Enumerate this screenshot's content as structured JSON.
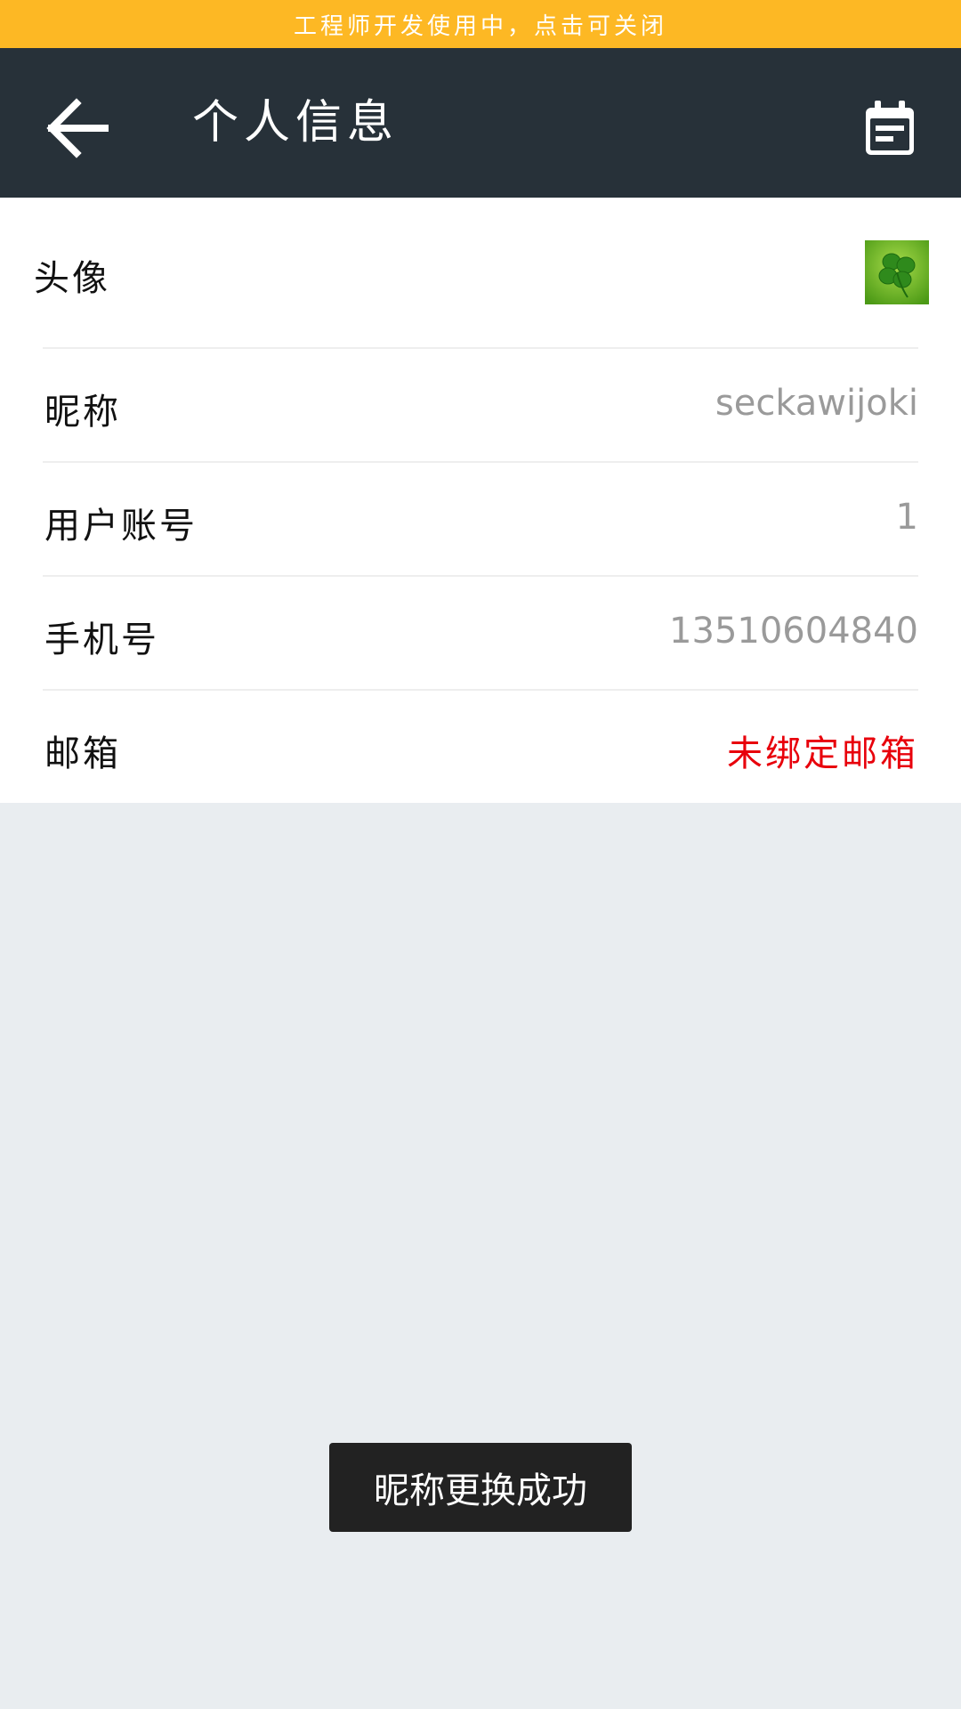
{
  "dev_banner": {
    "text": "工程师开发使用中，点击可关闭",
    "bg_color": "#fdb824"
  },
  "header": {
    "title": "个人信息",
    "back_icon": "arrow-left-icon",
    "action_icon": "calendar-note-icon",
    "bg_color": "#273139"
  },
  "profile": {
    "avatar": {
      "label": "头像",
      "image": "four-leaf-clover"
    },
    "nickname": {
      "label": "昵称",
      "value": "seckawijoki"
    },
    "account": {
      "label": "用户账号",
      "value": "1"
    },
    "phone": {
      "label": "手机号",
      "value": "13510604840"
    },
    "email": {
      "label": "邮箱",
      "value": "未绑定邮箱",
      "value_color": "#e8000b"
    }
  },
  "toast": {
    "text": "昵称更换成功"
  }
}
